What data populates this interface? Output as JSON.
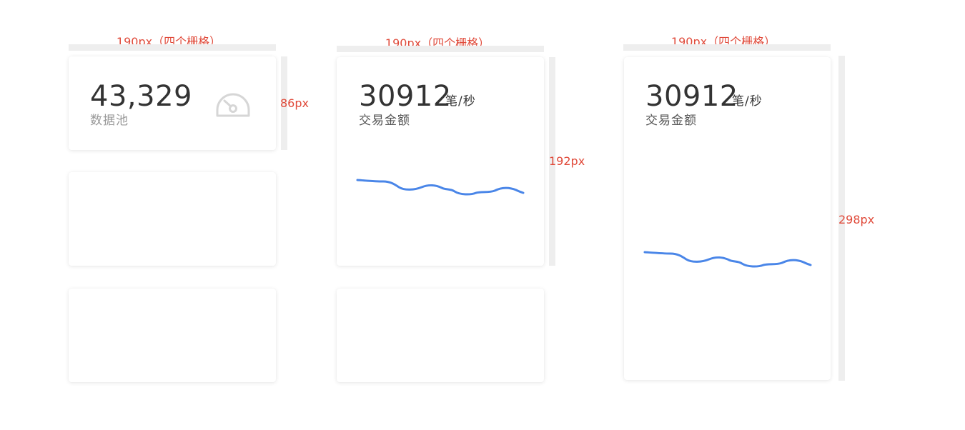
{
  "annotations": {
    "col1_width": "190px（四个栅格）",
    "col2_width": "190px（四个栅格）",
    "col3_width": "190px（四个栅格）",
    "h_small": "86px",
    "h_medium": "192px",
    "h_large": "298px"
  },
  "card_small": {
    "value": "43,329",
    "label": "数据池",
    "icon": "speedometer-icon"
  },
  "card_medium": {
    "value": "30912",
    "unit": "笔/秒",
    "label": "交易金额"
  },
  "card_large": {
    "value": "30912",
    "unit": "笔/秒",
    "label": "交易金额"
  },
  "colors": {
    "annotation": "#e04a3a",
    "sparkline": "#4a86e8",
    "guide": "#eeeeee"
  }
}
